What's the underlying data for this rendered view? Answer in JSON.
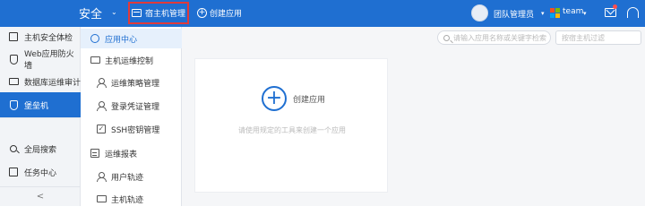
{
  "topbar": {
    "brand": "安全",
    "host_button": "宿主机管理",
    "create_button": "创建应用",
    "team_manager": "团队管理员",
    "team": "team",
    "accent": "#1f6fd1",
    "highlight": "#e03a3a"
  },
  "nav1": {
    "items": [
      {
        "label": "主机安全体检",
        "icon": "monitor-icon"
      },
      {
        "label": "Web应用防火墙",
        "icon": "shield-icon"
      },
      {
        "label": "数据库运维审计",
        "icon": "database-icon"
      },
      {
        "label": "堡垒机",
        "icon": "shield-icon",
        "active": true
      },
      {
        "label": "全局搜索",
        "icon": "search-icon"
      },
      {
        "label": "任务中心",
        "icon": "task-icon"
      }
    ],
    "collapse": "<"
  },
  "nav2": {
    "items": [
      {
        "label": "应用中心",
        "active": true
      },
      {
        "label": "主机运维控制"
      },
      {
        "label": "运维策略管理"
      },
      {
        "label": "登录凭证管理"
      },
      {
        "label": "SSH密钥管理"
      },
      {
        "label": "运维报表"
      },
      {
        "label": "用户轨迹"
      },
      {
        "label": "主机轨迹"
      }
    ]
  },
  "main": {
    "search_placeholder": "请输入应用名称或关键字检索",
    "filter_placeholder": "按宿主机过滤",
    "card": {
      "create_label": "创建应用",
      "hint": "请使用规定的工具来创建一个应用"
    }
  }
}
